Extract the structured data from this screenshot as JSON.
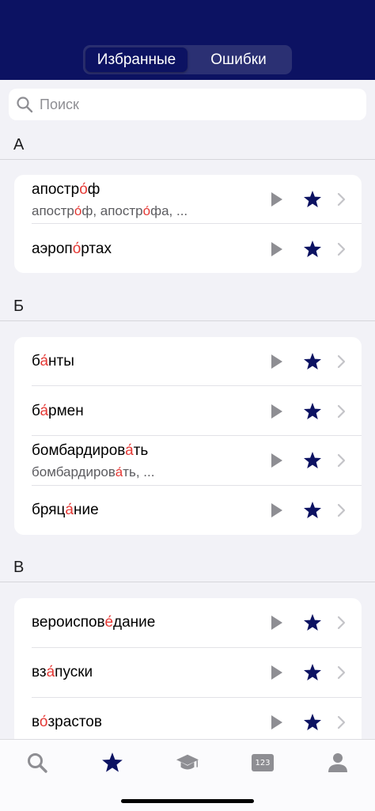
{
  "tabs": {
    "favorites": "Избранные",
    "errors": "Ошибки"
  },
  "search": {
    "placeholder": "Поиск"
  },
  "sections": [
    {
      "letter": "А",
      "items": [
        {
          "word": {
            "pre": "апостр",
            "acc": "о́",
            "post": "ф"
          },
          "forms": {
            "pre1": "апостр",
            "acc1": "о́",
            "mid": "ф, апостр",
            "acc2": "о́",
            "post": "фа, ..."
          }
        },
        {
          "word": {
            "pre": "аэроп",
            "acc": "о́",
            "post": "ртах"
          }
        }
      ]
    },
    {
      "letter": "Б",
      "items": [
        {
          "word": {
            "pre": "б",
            "acc": "а́",
            "post": "нты"
          }
        },
        {
          "word": {
            "pre": "б",
            "acc": "а́",
            "post": "рмен"
          }
        },
        {
          "word": {
            "pre": "бомбардиров",
            "acc": "а́",
            "post": "ть"
          },
          "forms": {
            "pre1": "бомбардиров",
            "acc1": "а́",
            "mid": "ть, ...",
            "acc2": "",
            "post": ""
          }
        },
        {
          "word": {
            "pre": "бряц",
            "acc": "а́",
            "post": "ние"
          }
        }
      ]
    },
    {
      "letter": "В",
      "items": [
        {
          "word": {
            "pre": "вероиспов",
            "acc": "е́",
            "post": "дание"
          }
        },
        {
          "word": {
            "pre": "вз",
            "acc": "а́",
            "post": "пуски"
          }
        },
        {
          "word": {
            "pre": "в",
            "acc": "о́",
            "post": "зрастов"
          }
        }
      ]
    }
  ],
  "tabbar": {
    "items": [
      "search-icon",
      "star-icon",
      "graduation-cap-icon",
      "numbers-icon",
      "person-icon"
    ],
    "numbers_label": "123"
  },
  "colors": {
    "navy": "#0c1262",
    "accent_red": "#e53935",
    "gray_icon": "#8e8e93"
  }
}
